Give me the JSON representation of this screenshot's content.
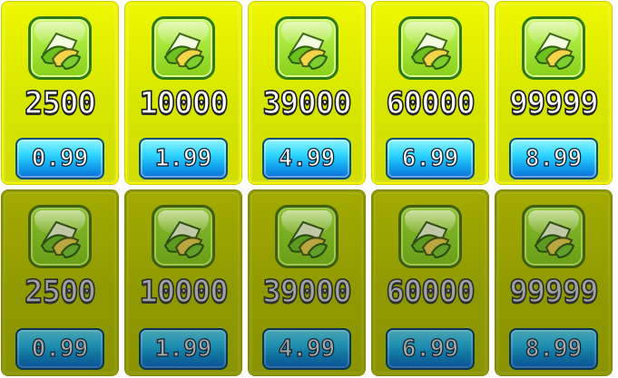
{
  "rows": [
    {
      "state": "active",
      "cards": [
        {
          "amount": "2500",
          "price": "0.99"
        },
        {
          "amount": "10000",
          "price": "1.99"
        },
        {
          "amount": "39000",
          "price": "4.99"
        },
        {
          "amount": "60000",
          "price": "6.99"
        },
        {
          "amount": "99999",
          "price": "8.99"
        }
      ]
    },
    {
      "state": "dimmed",
      "cards": [
        {
          "amount": "2500",
          "price": "0.99"
        },
        {
          "amount": "10000",
          "price": "1.99"
        },
        {
          "amount": "39000",
          "price": "4.99"
        },
        {
          "amount": "60000",
          "price": "6.99"
        },
        {
          "amount": "99999",
          "price": "8.99"
        }
      ]
    }
  ],
  "icon": "leaf-bundle-icon",
  "colors": {
    "card_active": "#e3ef00",
    "card_dimmed": "#97a100",
    "button_active": "#1ec2ff",
    "button_dimmed": "#1a82a8",
    "icon_bg": "#a8e63a",
    "icon_border": "#2e7a12"
  }
}
